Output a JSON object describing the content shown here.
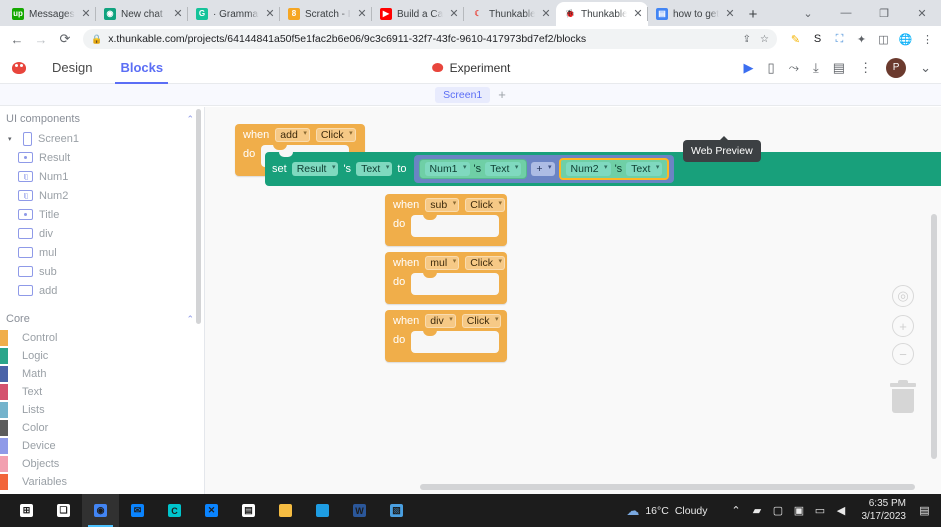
{
  "browser": {
    "tabs": [
      {
        "label": "Messages",
        "favicon": "upwork-icon",
        "color": "#14a800",
        "glyph": "up",
        "active": false
      },
      {
        "label": "New chat",
        "favicon": "chatgpt-icon",
        "color": "#10a37f",
        "glyph": "◉",
        "active": false
      },
      {
        "label": "· Grammarl",
        "favicon": "grammarly-icon",
        "color": "#15c39a",
        "glyph": "G",
        "active": false
      },
      {
        "label": "Scratch - In",
        "favicon": "scratch-icon",
        "color": "#f5a623",
        "glyph": "8",
        "active": false
      },
      {
        "label": "Build a Calc",
        "favicon": "youtube-icon",
        "color": "#ff0000",
        "glyph": "▶",
        "active": false
      },
      {
        "label": "Thunkable",
        "favicon": "thunkable-icon",
        "color": "#ffffff",
        "glyph": "☾",
        "active": false
      },
      {
        "label": "Thunkable",
        "favicon": "thunkable-icon",
        "color": "#ffffff",
        "glyph": "🐞",
        "active": true
      },
      {
        "label": "how to get",
        "favicon": "docs-icon",
        "color": "#4285f4",
        "glyph": "▤",
        "active": false
      }
    ],
    "new_tab_label": "+",
    "window_controls": {
      "expand": "⌄",
      "minimize": "—",
      "maximize": "❐",
      "close": "✕"
    },
    "nav": {
      "back": "←",
      "forward": "→",
      "reload": "⟳"
    },
    "url": "x.thunkable.com/projects/64144841a50f5e1fac2b6e06/9c3c6911-32f7-43fc-9610-417973bd7ef2/blocks",
    "lock_icon": "🔒",
    "omnibox_tail": {
      "share": "⇪",
      "bookmark": "☆"
    },
    "extensions": [
      {
        "name": "highlighter-extension-icon",
        "glyph": "✎",
        "color": "#f4b400"
      },
      {
        "name": "s-extension-icon",
        "glyph": "S",
        "color": "#202124"
      },
      {
        "name": "capture-extension-icon",
        "glyph": "⛶",
        "color": "#4a90d9"
      },
      {
        "name": "puzzle-extensions-icon",
        "glyph": "✦",
        "color": "#5f6368"
      },
      {
        "name": "split-view-icon",
        "glyph": "◫",
        "color": "#5f6368"
      },
      {
        "name": "globe-extension-icon",
        "glyph": "🌐",
        "color": "#2b6cb0"
      },
      {
        "name": "chrome-menu-icon",
        "glyph": "⋮",
        "color": "#5f6368"
      }
    ]
  },
  "app": {
    "tabs": [
      {
        "label": "Design",
        "selected": false
      },
      {
        "label": "Blocks",
        "selected": true
      }
    ],
    "project_name": "Experiment",
    "header_tools": [
      {
        "name": "web-preview-play-button",
        "glyph": "▶"
      },
      {
        "name": "device-preview-icon",
        "glyph": "▯"
      },
      {
        "name": "share-icon",
        "glyph": "⤳"
      },
      {
        "name": "download-icon",
        "glyph": "⤓"
      },
      {
        "name": "docs-icon",
        "glyph": "▤"
      },
      {
        "name": "more-options-icon",
        "glyph": "⋮"
      }
    ],
    "avatar_initial": "P",
    "avatar_caret": "⌄",
    "tooltip": "Web Preview",
    "screen_tab": "Screen1",
    "add_screen": "+",
    "accent_color": "#5b6ef5"
  },
  "sidebar": {
    "ui_components": {
      "title": "UI components",
      "collapse_icon": "⌃",
      "tree": [
        {
          "label": "Screen1",
          "icon": "screen-icon",
          "depth": 0,
          "twist": "▾"
        },
        {
          "label": "Result",
          "icon": "label-icon",
          "depth": 1
        },
        {
          "label": "Num1",
          "icon": "textinput-icon",
          "depth": 1
        },
        {
          "label": "Num2",
          "icon": "textinput-icon",
          "depth": 1
        },
        {
          "label": "Title",
          "icon": "label-icon",
          "depth": 1
        },
        {
          "label": "div",
          "icon": "button-icon",
          "depth": 1
        },
        {
          "label": "mul",
          "icon": "button-icon",
          "depth": 1
        },
        {
          "label": "sub",
          "icon": "button-icon",
          "depth": 1
        },
        {
          "label": "add",
          "icon": "button-icon",
          "depth": 1
        }
      ]
    },
    "core": {
      "title": "Core",
      "collapse_icon": "⌃",
      "categories": [
        {
          "label": "Control",
          "color": "#f0ae4a"
        },
        {
          "label": "Logic",
          "color": "#2aa58a"
        },
        {
          "label": "Math",
          "color": "#4a63a8"
        },
        {
          "label": "Text",
          "color": "#d4526e"
        },
        {
          "label": "Lists",
          "color": "#74b3cc"
        },
        {
          "label": "Color",
          "color": "#5c5c5c"
        },
        {
          "label": "Device",
          "color": "#8f9ae8"
        },
        {
          "label": "Objects",
          "color": "#f2a0b0"
        },
        {
          "label": "Variables",
          "color": "#f2653a"
        }
      ]
    }
  },
  "canvas": {
    "blocks": [
      {
        "id": "when-add-click",
        "kw_when": "when",
        "component": "add",
        "event": "Click",
        "kw_do": "do",
        "body": {
          "kw_set": "set",
          "target_component": "Result",
          "possessive": "'s",
          "target_property": "Text",
          "kw_to": "to",
          "expression": {
            "left": {
              "component": "Num1",
              "possessive": "'s",
              "property": "Text"
            },
            "operator": "+",
            "right": {
              "component": "Num2",
              "possessive": "'s",
              "property": "Text",
              "selected": true
            }
          }
        }
      },
      {
        "id": "when-sub-click",
        "kw_when": "when",
        "component": "sub",
        "event": "Click",
        "kw_do": "do",
        "body": null
      },
      {
        "id": "when-mul-click",
        "kw_when": "when",
        "component": "mul",
        "event": "Click",
        "kw_do": "do",
        "body": null
      },
      {
        "id": "when-div-click",
        "kw_when": "when",
        "component": "div",
        "event": "Click",
        "kw_do": "do",
        "body": null
      }
    ],
    "controls": [
      {
        "name": "center-blocks-icon",
        "glyph": "◎"
      },
      {
        "name": "zoom-in-button",
        "glyph": "+"
      },
      {
        "name": "zoom-out-button",
        "glyph": "−"
      },
      {
        "name": "trash-can-icon",
        "glyph": ""
      }
    ]
  },
  "taskbar": {
    "items": [
      {
        "name": "start-button",
        "glyph": "⊞",
        "color": "#ffffff",
        "active": false
      },
      {
        "name": "task-view-button",
        "glyph": "❏",
        "color": "#ffffff",
        "active": false
      },
      {
        "name": "chrome-taskbar-icon",
        "glyph": "◉",
        "color": "#4285f4",
        "active": true
      },
      {
        "name": "mail-taskbar-icon",
        "glyph": "✉",
        "color": "#0a84ff",
        "active": false
      },
      {
        "name": "canva-taskbar-icon",
        "glyph": "C",
        "color": "#00c4cc",
        "active": false
      },
      {
        "name": "vscode-taskbar-icon",
        "glyph": "✕",
        "color": "#0a84ff",
        "active": false
      },
      {
        "name": "store-taskbar-icon",
        "glyph": "▤",
        "color": "#ffffff",
        "active": false
      },
      {
        "name": "explorer-taskbar-icon",
        "glyph": "📁",
        "color": "#f5bc42",
        "active": false
      },
      {
        "name": "edge-taskbar-icon",
        "glyph": "◯",
        "color": "#1e9de3",
        "active": false
      },
      {
        "name": "word-taskbar-icon",
        "glyph": "W",
        "color": "#2b579a",
        "active": false
      },
      {
        "name": "photos-taskbar-icon",
        "glyph": "▧",
        "color": "#4a9fe0",
        "active": false
      }
    ],
    "weather": {
      "icon": "cloud-icon",
      "temperature": "16°C",
      "condition": "Cloudy"
    },
    "tray": [
      {
        "name": "show-hidden-icons-chevron",
        "glyph": "⌃"
      },
      {
        "name": "wifi-icon",
        "glyph": "▰"
      },
      {
        "name": "onedrive-icon",
        "glyph": "▢"
      },
      {
        "name": "antivirus-icon",
        "glyph": "▣"
      },
      {
        "name": "battery-icon",
        "glyph": "▭"
      },
      {
        "name": "volume-icon",
        "glyph": "◀"
      }
    ],
    "clock": {
      "time": "6:35 PM",
      "date": "3/17/2023"
    },
    "notifications_icon": "▤"
  }
}
